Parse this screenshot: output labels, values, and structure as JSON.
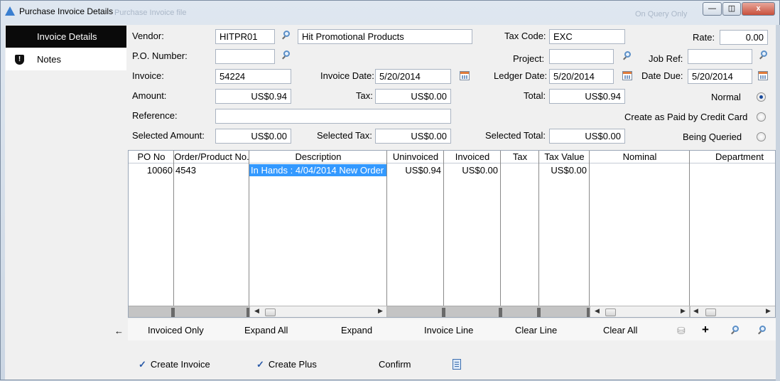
{
  "window": {
    "title": "Purchase Invoice Details",
    "ghost_left": "Purchase Invoice file",
    "ghost_right": "On Query Only",
    "minimize": "—",
    "restore": "◫",
    "close": "x"
  },
  "sidebar": {
    "items": [
      {
        "label": "Invoice Details",
        "active": true
      },
      {
        "label": "Notes",
        "icon": "shield-icon"
      }
    ]
  },
  "form": {
    "vendor_label": "Vendor:",
    "vendor_code": "HITPR01",
    "vendor_name": "Hit Promotional Products",
    "tax_code_label": "Tax Code:",
    "tax_code": "EXC",
    "rate_label": "Rate:",
    "rate": "0.00",
    "po_label": "P.O. Number:",
    "po_number": "",
    "project_label": "Project:",
    "project": "",
    "job_ref_label": "Job Ref:",
    "job_ref": "",
    "invoice_label": "Invoice:",
    "invoice": "54224",
    "invoice_date_label": "Invoice Date:",
    "invoice_date": "5/20/2014",
    "ledger_date_label": "Ledger Date:",
    "ledger_date": "5/20/2014",
    "date_due_label": "Date Due:",
    "date_due": "5/20/2014",
    "amount_label": "Amount:",
    "amount": "US$0.94",
    "tax_label": "Tax:",
    "tax": "US$0.00",
    "total_label": "Total:",
    "total": "US$0.94",
    "reference_label": "Reference:",
    "reference": "",
    "selected_amount_label": "Selected Amount:",
    "selected_amount": "US$0.00",
    "selected_tax_label": "Selected Tax:",
    "selected_tax": "US$0.00",
    "selected_total_label": "Selected Total:",
    "selected_total": "US$0.00",
    "status_options": [
      {
        "label": "Normal",
        "selected": true
      },
      {
        "label": "Create as Paid by Credit Card",
        "selected": false
      },
      {
        "label": "Being Queried",
        "selected": false
      }
    ]
  },
  "grid": {
    "columns": [
      "PO No",
      "Order/Product No.",
      "Description",
      "Uninvoiced",
      "Invoiced",
      "Tax",
      "Tax Value",
      "Nominal",
      "Department"
    ],
    "rows": [
      [
        "10060",
        "4543",
        "In Hands :  4/04/2014 New Order",
        "US$0.94",
        "US$0.00",
        "",
        "US$0.00",
        "",
        ""
      ]
    ]
  },
  "toolbar": {
    "back": "←",
    "invoiced_only": "Invoiced Only",
    "expand_all": "Expand All",
    "expand": "Expand",
    "invoice_line": "Invoice Line",
    "clear_line": "Clear Line",
    "clear_all": "Clear All",
    "icons": [
      "binoculars-icon",
      "plus-icon",
      "zoom-in-icon",
      "zoom-out-icon"
    ]
  },
  "actions": {
    "create_invoice": "Create Invoice",
    "create_plus": "Create Plus",
    "confirm": "Confirm"
  }
}
